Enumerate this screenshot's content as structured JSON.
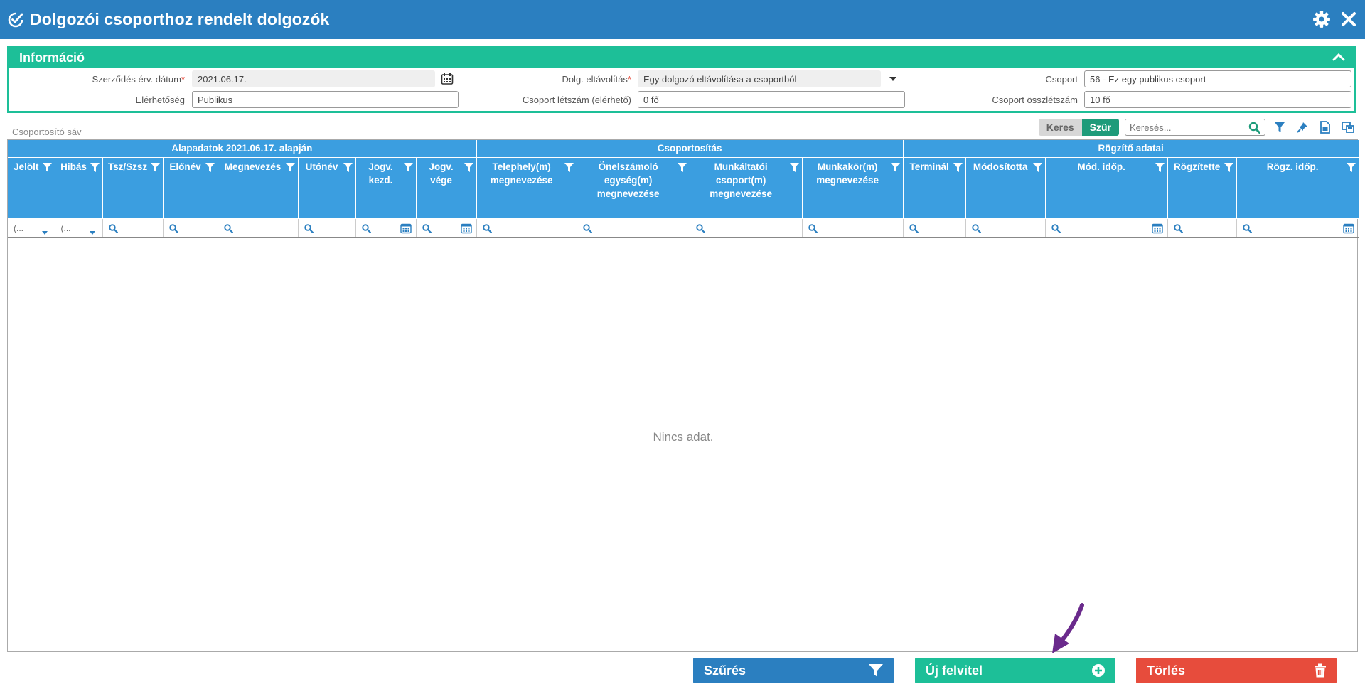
{
  "window": {
    "title": "Dolgozói csoporthoz rendelt dolgozók",
    "title_icon": "check-circle-edit-icon",
    "controls": [
      "gear-icon",
      "close-icon"
    ]
  },
  "info": {
    "header": "Információ",
    "fields": {
      "contract_date": {
        "label": "Szerződés érv. dátum",
        "value": "2021.06.17.",
        "required": "*"
      },
      "removal": {
        "label": "Dolg. eltávolítás",
        "value": "Egy dolgozó eltávolítása a csoportból",
        "required": "*"
      },
      "group": {
        "label": "Csoport",
        "value": "56 - Ez egy publikus csoport"
      },
      "access": {
        "label": "Elérhetőség",
        "value": "Publikus"
      },
      "group_count": {
        "label": "Csoport létszám (elérhető)",
        "value": "0 fő"
      },
      "group_total": {
        "label": "Csoport összlétszám",
        "value": "10 fő"
      }
    }
  },
  "grouping_bar": "Csoportosító sáv",
  "toolbar": {
    "keres": "Keres",
    "szur": "Szűr",
    "search_placeholder": "Keresés..."
  },
  "grid": {
    "bands": [
      "Alapadatok 2021.06.17. alapján",
      "Csoportosítás",
      "Rögzítő adatai"
    ],
    "columns": [
      "Jelölt",
      "Hibás",
      "Tsz/Szsz",
      "Előnév",
      "Megnevezés",
      "Utónév",
      "Jogv. kezd.",
      "Jogv. vége",
      "Telephely(m) megnevezése",
      "Önelszámoló egység(m) megnevezése",
      "Munkáltatói csoport(m) megnevezése",
      "Munkakör(m) megnevezése",
      "Terminál",
      "Módosította",
      "Mód. időp.",
      "Rögzítette",
      "Rögz. időp."
    ],
    "filter_dropdown": "(...",
    "empty_text": "Nincs adat."
  },
  "buttons": {
    "filter": "Szűrés",
    "new": "Új felvitel",
    "delete": "Törlés"
  },
  "colors": {
    "title_bar": "#2b7fc0",
    "info_accent": "#1dbf98",
    "grid_header": "#3b9ee0",
    "delete": "#e74c3c",
    "arrow": "#6a2a8c"
  }
}
